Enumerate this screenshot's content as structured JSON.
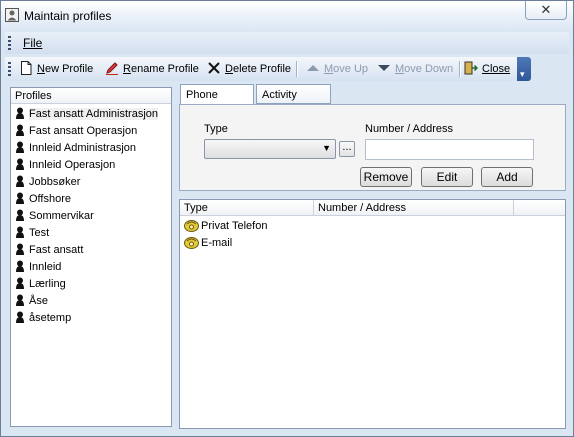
{
  "window": {
    "title": "Maintain profiles",
    "close_glyph": "✕"
  },
  "menubar": {
    "file": "File"
  },
  "toolbar": {
    "new_profile": "New Profile",
    "rename_profile": "Rename Profile",
    "delete_profile": "Delete Profile",
    "move_up": "Move Up",
    "move_down": "Move Down",
    "close": "Close",
    "overflow_glyph": "▾"
  },
  "profiles": {
    "header": "Profiles",
    "items": [
      "Fast ansatt Administrasjon",
      "Fast ansatt Operasjon",
      "Innleid Administrasjon",
      "Innleid Operasjon",
      "Jobbsøker",
      "Offshore",
      "Sommervikar",
      "Test",
      "Fast ansatt",
      "Innleid",
      "Lærling",
      "Åse",
      "åsetemp"
    ]
  },
  "tabs": {
    "phone": "Phone profile",
    "activity": "Activity profile"
  },
  "form": {
    "type_label": "Type",
    "number_label": "Number / Address",
    "type_value": "",
    "number_value": "",
    "ellipsis": "...",
    "remove": "Remove",
    "edit": "Edit",
    "add": "Add"
  },
  "list": {
    "col_type": "Type",
    "col_number": "Number / Address",
    "rows": [
      {
        "type": "Privat Telefon",
        "number": ""
      },
      {
        "type": "E-mail",
        "number": ""
      }
    ]
  },
  "colors": {
    "toolbar_overflow": "#2e5799",
    "window_bg": "#dbe6f3"
  }
}
